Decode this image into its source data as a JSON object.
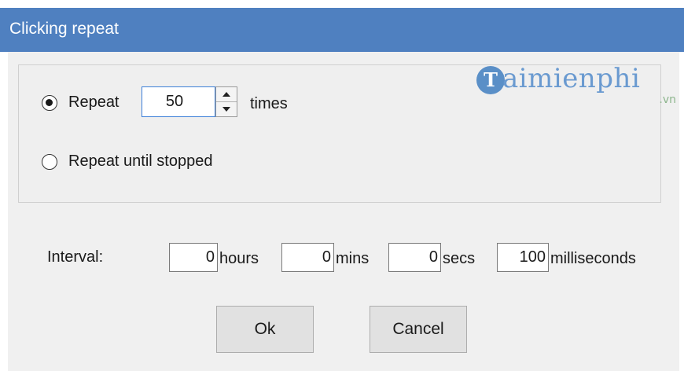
{
  "window": {
    "title": "Clicking repeat"
  },
  "watermark": {
    "mark": "T",
    "text": "aimienphi",
    "sub": ".vn"
  },
  "repeat": {
    "option_repeat_label": "Repeat",
    "repeat_count": "50",
    "times_label": "times",
    "option_until_stopped_label": "Repeat until stopped",
    "selected": "repeat"
  },
  "interval": {
    "label": "Interval:",
    "hours_value": "0",
    "hours_label": "hours",
    "mins_value": "0",
    "mins_label": "mins",
    "secs_value": "0",
    "secs_label": "secs",
    "ms_value": "100",
    "ms_label": "milliseconds"
  },
  "buttons": {
    "ok_label": "Ok",
    "cancel_label": "Cancel"
  },
  "colors": {
    "titlebar": "#4f80c0",
    "spin_focus_border": "#3c7fd8"
  }
}
